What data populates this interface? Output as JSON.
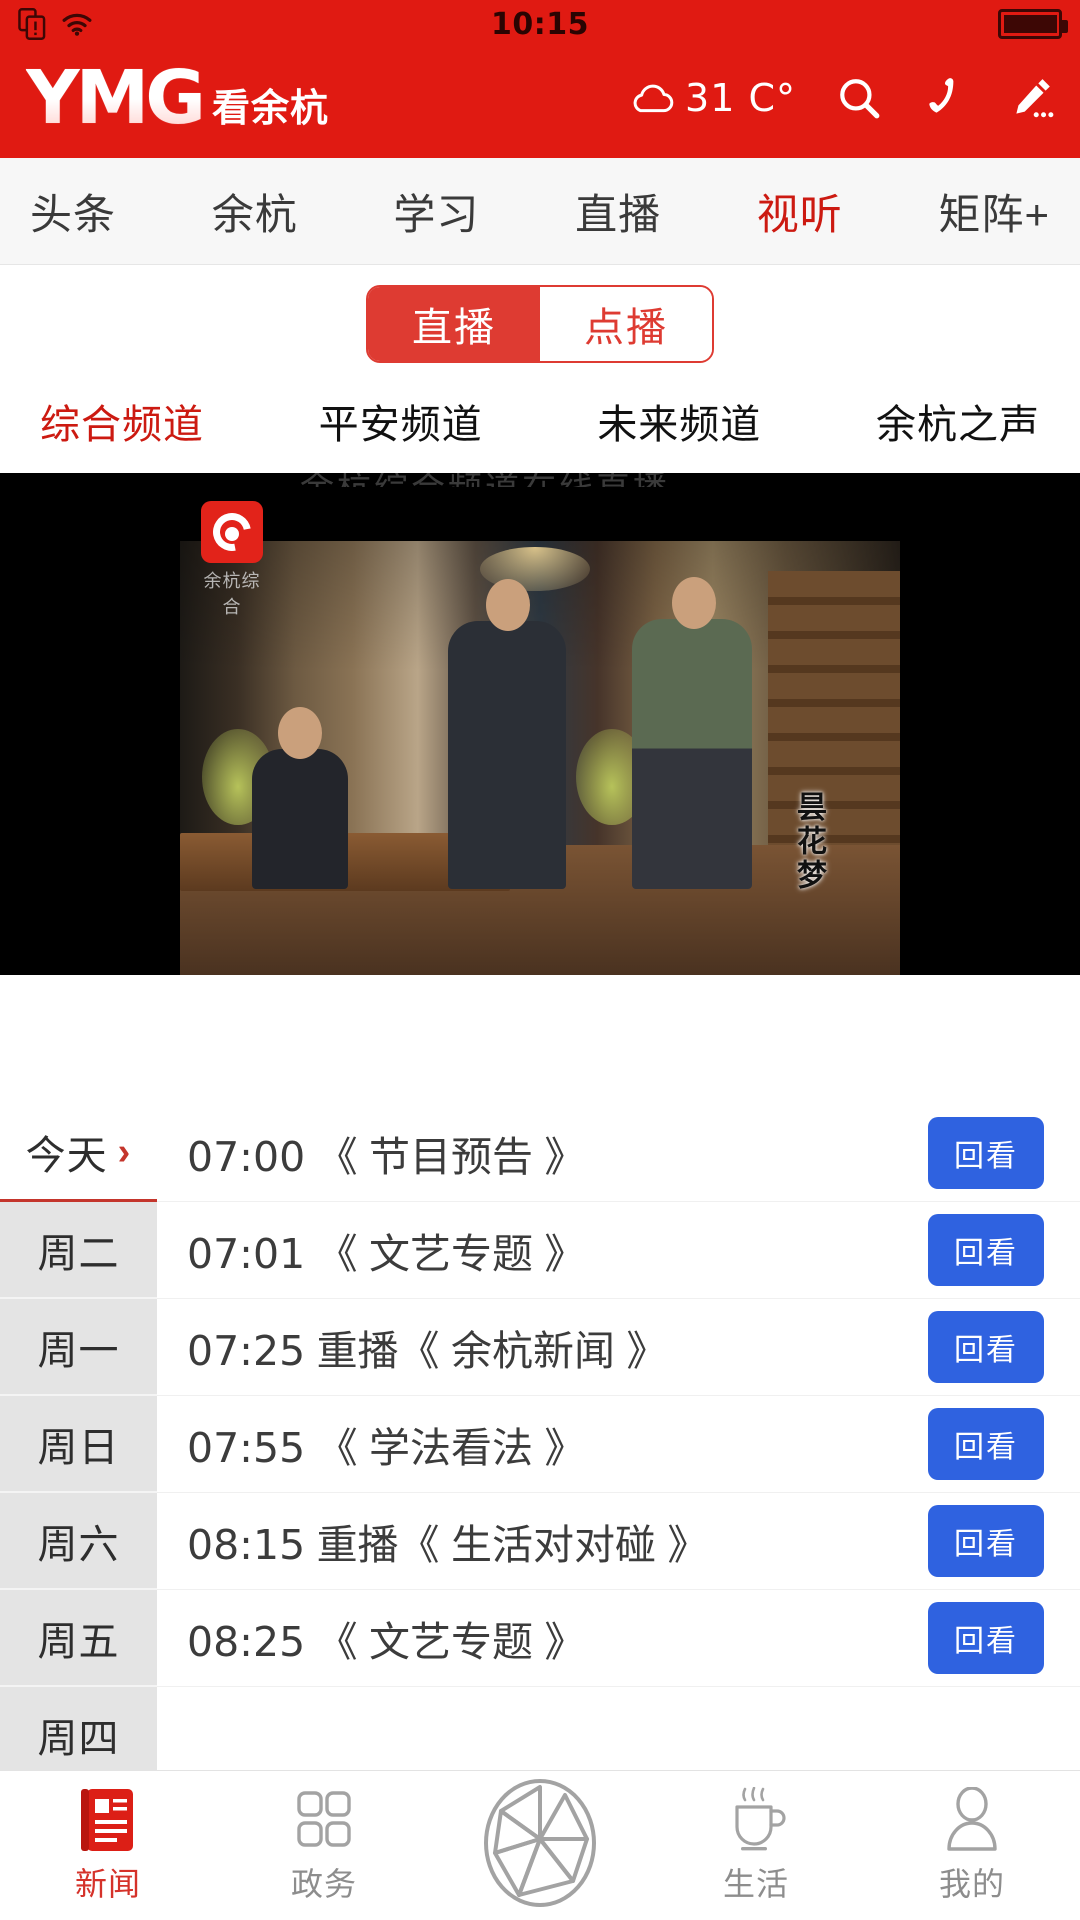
{
  "status_bar": {
    "time": "10:15",
    "icons": [
      "sim-card-alert-icon",
      "wifi-icon",
      "battery-icon"
    ]
  },
  "header": {
    "logo_main": "YMG",
    "logo_sub": "看余杭",
    "weather_icon": "cloud-icon",
    "temperature": "31 C°",
    "actions": [
      {
        "name": "search-icon",
        "label": "搜索"
      },
      {
        "name": "phone-icon",
        "label": "电话"
      },
      {
        "name": "pencil-icon",
        "label": "爆料"
      }
    ],
    "brand_color": "#e01a12"
  },
  "nav_tabs": {
    "items": [
      {
        "label": "头条",
        "active": false
      },
      {
        "label": "余杭",
        "active": false
      },
      {
        "label": "学习",
        "active": false
      },
      {
        "label": "直播",
        "active": false
      },
      {
        "label": "视听",
        "active": true
      },
      {
        "label": "矩阵+",
        "active": false
      }
    ],
    "active_color": "#cc1a11"
  },
  "segmented": {
    "options": [
      {
        "label": "直播",
        "selected": true
      },
      {
        "label": "点播",
        "selected": false
      }
    ],
    "accent": "#de3b32"
  },
  "channels": {
    "items": [
      {
        "label": "综合频道",
        "active": true
      },
      {
        "label": "平安频道",
        "active": false
      },
      {
        "label": "未来频道",
        "active": false
      },
      {
        "label": "余杭之声",
        "active": false
      }
    ]
  },
  "player": {
    "channel_watermark": "余杭综合",
    "program_overlay_title": "昙花梦",
    "ghost_text": "余杭综合频道在线直播"
  },
  "schedule": {
    "days": [
      {
        "label": "今天",
        "active": true,
        "chevron": "›"
      },
      {
        "label": "周二",
        "active": false
      },
      {
        "label": "周一",
        "active": false
      },
      {
        "label": "周日",
        "active": false
      },
      {
        "label": "周六",
        "active": false
      },
      {
        "label": "周五",
        "active": false
      },
      {
        "label": "周四",
        "active": false
      }
    ],
    "button_label": "回看",
    "button_color": "#2f62e0",
    "programs": [
      {
        "time": "07:00",
        "title": "《 节目预告 》",
        "replay": "回看"
      },
      {
        "time": "07:01",
        "title": "《 文艺专题 》",
        "replay": "回看"
      },
      {
        "time": "07:25",
        "title": "重播《 余杭新闻 》",
        "replay": "回看"
      },
      {
        "time": "07:55",
        "title": "《 学法看法 》",
        "replay": "回看"
      },
      {
        "time": "08:15",
        "title": "重播《 生活对对碰 》",
        "replay": "回看"
      },
      {
        "time": "08:25",
        "title": "《 文艺专题 》",
        "replay": "回看"
      }
    ]
  },
  "tabbar": {
    "items": [
      {
        "label": "新闻",
        "icon": "news-icon",
        "active": true
      },
      {
        "label": "政务",
        "icon": "grid-icon",
        "active": false
      },
      {
        "label": "",
        "icon": "aperture-icon",
        "active": false
      },
      {
        "label": "生活",
        "icon": "cup-icon",
        "active": false
      },
      {
        "label": "我的",
        "icon": "person-icon",
        "active": false
      }
    ],
    "active_color": "#d5322a"
  }
}
